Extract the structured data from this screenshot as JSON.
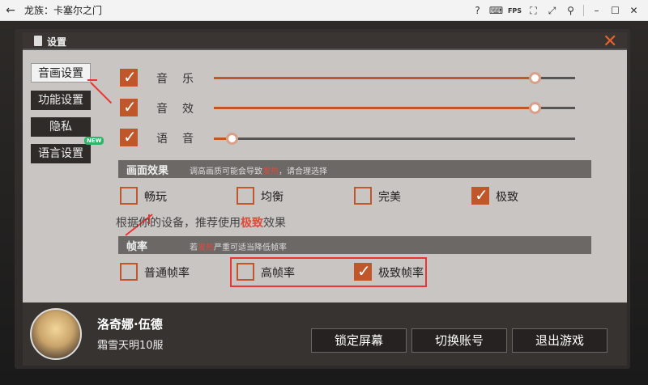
{
  "window": {
    "title": "龙族：卡塞尔之门",
    "fps_label": "FPS"
  },
  "settings": {
    "title": "设置"
  },
  "nav": {
    "items": [
      {
        "label": "音画设置"
      },
      {
        "label": "功能设置"
      },
      {
        "label": "隐私"
      },
      {
        "label": "语言设置"
      }
    ],
    "new_badge": "NEW"
  },
  "audio": {
    "rows": [
      {
        "label": "音乐",
        "checked": true,
        "level": 0.94
      },
      {
        "label": "音效",
        "checked": true,
        "level": 0.94
      },
      {
        "label": "语音",
        "checked": true,
        "level": 0.05
      }
    ]
  },
  "graphics": {
    "title": "画面效果",
    "note_prefix": "调高画质可能会导致",
    "note_red": "发热",
    "note_suffix": "，请合理选择",
    "options": [
      {
        "label": "畅玩",
        "checked": false
      },
      {
        "label": "均衡",
        "checked": false
      },
      {
        "label": "完美",
        "checked": false
      },
      {
        "label": "极致",
        "checked": true
      }
    ],
    "recommend_prefix": "根据你的设备，推荐使用",
    "recommend_highlight": "极致",
    "recommend_suffix": "效果"
  },
  "framerate": {
    "title": "帧率",
    "note_prefix": "若",
    "note_red": "发热",
    "note_suffix": "严重可适当降低帧率",
    "options": [
      {
        "label": "普通帧率",
        "checked": false
      },
      {
        "label": "高帧率",
        "checked": false
      },
      {
        "label": "极致帧率",
        "checked": true
      }
    ]
  },
  "player": {
    "name": "洛奇娜·伍德",
    "server": "霜雪天明10服"
  },
  "footer": {
    "lock_screen": "锁定屏幕",
    "switch_account": "切换账号",
    "exit_game": "退出游戏"
  },
  "colors": {
    "accent": "#c0572b",
    "annotation_red": "#e33333"
  }
}
